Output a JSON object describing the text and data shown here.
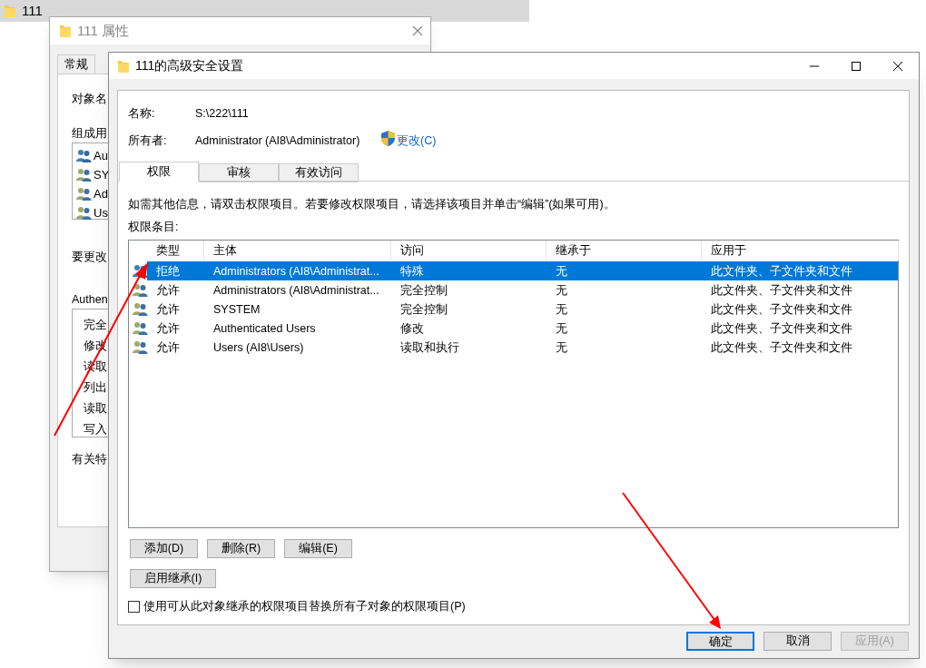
{
  "explorer_row": {
    "name": "111"
  },
  "properties_window": {
    "title": "111 属性",
    "tabs": [
      {
        "label": "常规",
        "selected": false
      }
    ],
    "labels": [
      "对象名",
      "组成用"
    ],
    "users": [
      "Au",
      "SY",
      "Ad",
      "Us"
    ],
    "change_label": "要更改",
    "perm_label": "Authen",
    "perms": [
      "完全",
      "修改",
      "读取",
      "列出",
      "读取",
      "写入"
    ],
    "footer": "有关特"
  },
  "dialog": {
    "title": "111的高级安全设置",
    "name_label": "名称:",
    "name_value": "S:\\222\\111",
    "owner_label": "所有者:",
    "owner_value": "Administrator (AI8\\Administrator)",
    "owner_link": "更改(C)",
    "tabs": [
      {
        "label": "权限",
        "selected": true
      },
      {
        "label": "审核",
        "selected": false
      },
      {
        "label": "有效访问",
        "selected": false
      }
    ],
    "info": "如需其他信息，请双击权限项目。若要修改权限项目，请选择该项目并单击“编辑”(如果可用)。",
    "list_label": "权限条目:",
    "table": {
      "columns": [
        "类型",
        "主体",
        "访问",
        "继承于",
        "应用于"
      ],
      "rows": [
        {
          "selected": true,
          "cells": [
            "拒绝",
            "Administrators (AI8\\Administrat...",
            "特殊",
            "无",
            "此文件夹、子文件夹和文件"
          ]
        },
        {
          "selected": false,
          "cells": [
            "允许",
            "Administrators (AI8\\Administrat...",
            "完全控制",
            "无",
            "此文件夹、子文件夹和文件"
          ]
        },
        {
          "selected": false,
          "cells": [
            "允许",
            "SYSTEM",
            "完全控制",
            "无",
            "此文件夹、子文件夹和文件"
          ]
        },
        {
          "selected": false,
          "cells": [
            "允许",
            "Authenticated Users",
            "修改",
            "无",
            "此文件夹、子文件夹和文件"
          ]
        },
        {
          "selected": false,
          "cells": [
            "允许",
            "Users (AI8\\Users)",
            "读取和执行",
            "无",
            "此文件夹、子文件夹和文件"
          ]
        }
      ]
    },
    "row_buttons": [
      "添加(D)",
      "删除(R)",
      "编辑(E)"
    ],
    "inherit_button": "启用继承(I)",
    "replace_checkbox": {
      "label": "使用可从此对象继承的权限项目替换所有子对象的权限项目(P)",
      "checked": false
    },
    "footer_buttons": [
      {
        "label": "确定",
        "kind": "default",
        "disabled": false
      },
      {
        "label": "取消",
        "kind": "normal",
        "disabled": false
      },
      {
        "label": "应用(A)",
        "kind": "normal",
        "disabled": true
      }
    ]
  }
}
